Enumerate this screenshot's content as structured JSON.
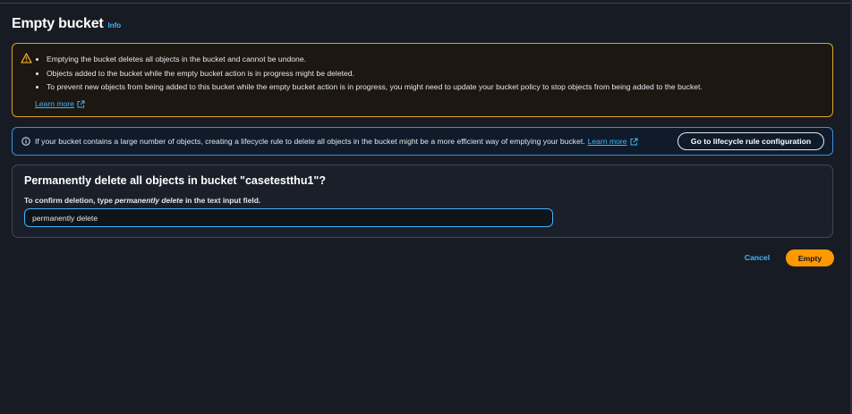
{
  "header": {
    "title": "Empty bucket",
    "info_label": "Info"
  },
  "warning": {
    "icon": "warning-triangle-icon",
    "items": [
      "Emptying the bucket deletes all objects in the bucket and cannot be undone.",
      "Objects added to the bucket while the empty bucket action is in progress might be deleted.",
      "To prevent new objects from being added to this bucket while the empty bucket action is in progress, you might need to update your bucket policy to stop objects from being added to the bucket."
    ],
    "learn_more": "Learn more"
  },
  "info_alert": {
    "icon": "info-circle-icon",
    "text": "If your bucket contains a large number of objects, creating a lifecycle rule to delete all objects in the bucket might be a more efficient way of emptying your bucket.",
    "learn_more": "Learn more",
    "button_label": "Go to lifecycle rule configuration"
  },
  "confirm": {
    "heading": "Permanently delete all objects in bucket \"casetestthu1\"?",
    "instruction_prefix": "To confirm deletion, type ",
    "instruction_keyword": "permanently delete",
    "instruction_suffix": " in the text input field.",
    "input_value": "permanently delete"
  },
  "actions": {
    "cancel_label": "Cancel",
    "empty_label": "Empty"
  },
  "colors": {
    "background": "#171b24",
    "warning_border": "#e0a32e",
    "info_border": "#3d8fe0",
    "link": "#42b4ff",
    "primary_button": "#ff9900"
  }
}
